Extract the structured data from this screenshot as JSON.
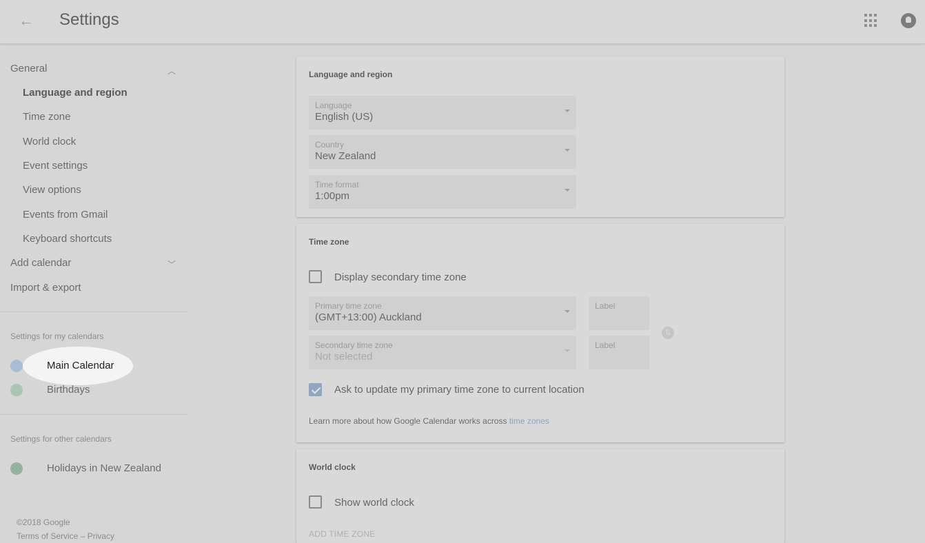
{
  "header": {
    "back_icon": "arrow-back-icon",
    "title": "Settings",
    "apps_icon": "apps-grid-icon",
    "account_icon": "account-avatar-icon"
  },
  "sidebar": {
    "general": "General",
    "items": [
      "Language and region",
      "Time zone",
      "World clock",
      "Event settings",
      "View options",
      "Events from Gmail",
      "Keyboard shortcuts"
    ],
    "add_calendar": "Add calendar",
    "import_export": "Import & export",
    "my_calendars_heading": "Settings for my calendars",
    "my_calendars": [
      {
        "name": "Main Calendar",
        "color": "#a9bcd4"
      },
      {
        "name": "Birthdays",
        "color": "#a7c7b4"
      }
    ],
    "other_calendars_heading": "Settings for other calendars",
    "other_calendars": [
      {
        "name": "Holidays in New Zealand",
        "color": "#95b3a1"
      }
    ],
    "copyright": "©2018 Google",
    "terms": "Terms of Service – Privacy"
  },
  "language_region": {
    "title": "Language and region",
    "language_label": "Language",
    "language_value": "English (US)",
    "country_label": "Country",
    "country_value": "New Zealand",
    "time_format_label": "Time format",
    "time_format_value": "1:00pm"
  },
  "time_zone": {
    "title": "Time zone",
    "display_secondary": "Display secondary time zone",
    "primary_label": "Primary time zone",
    "primary_value": "(GMT+13:00) Auckland",
    "primary_tag_label": "Label",
    "secondary_label": "Secondary time zone",
    "secondary_value": "Not selected",
    "secondary_tag_label": "Label",
    "ask_update": "Ask to update my primary time zone to current location",
    "learn_more": "Learn more about how Google Calendar works across ",
    "learn_link": "time zones"
  },
  "world_clock": {
    "title": "World clock",
    "show_world_clock": "Show world clock",
    "add_time_zone": "ADD TIME ZONE"
  },
  "colors": {
    "checkbox_checked": "#8fa6c4",
    "link": "#8ea3c2"
  }
}
